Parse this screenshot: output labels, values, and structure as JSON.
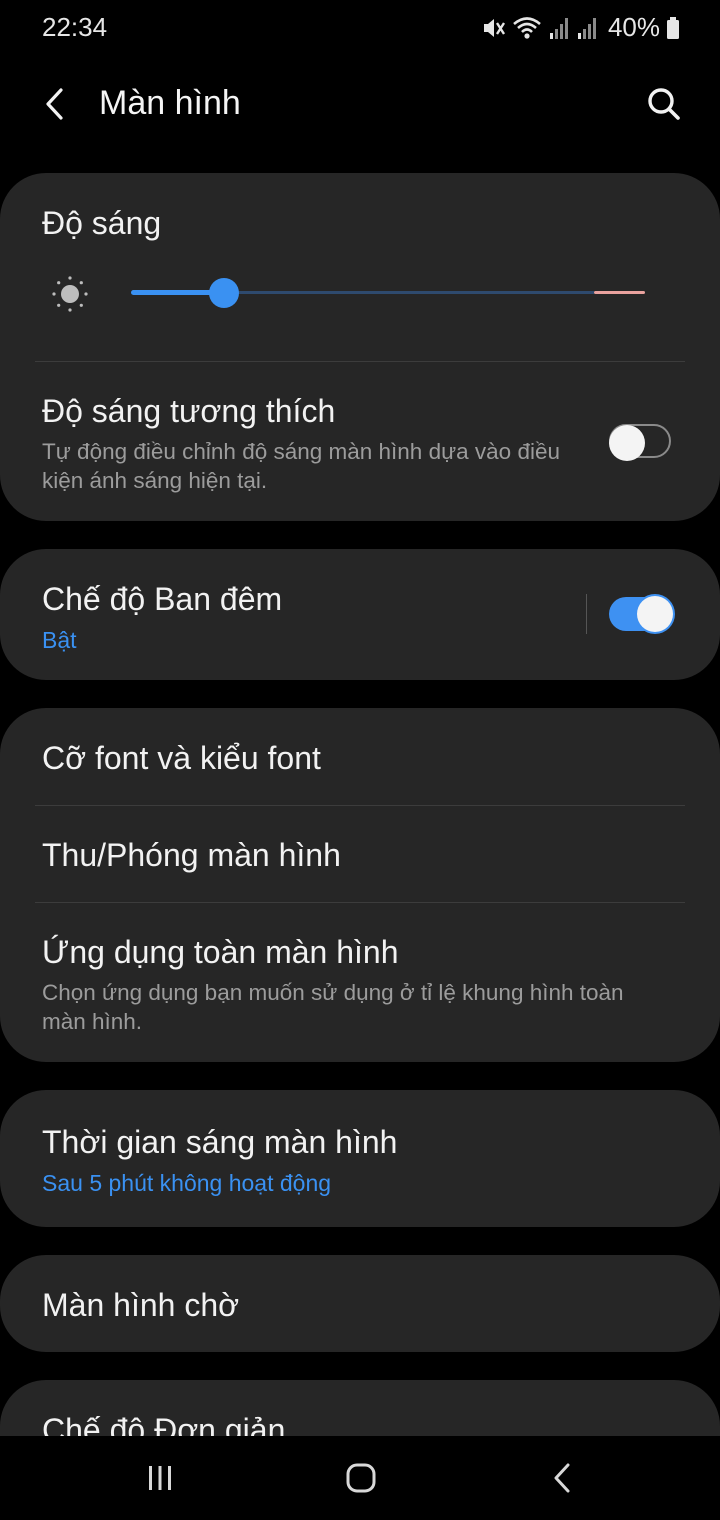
{
  "status_bar": {
    "time": "22:34",
    "battery": "40%"
  },
  "header": {
    "title": "Màn hình"
  },
  "brightness": {
    "title": "Độ sáng",
    "level": 0.18
  },
  "adaptive": {
    "title": "Độ sáng tương thích",
    "subtitle": "Tự động điều chỉnh độ sáng màn hình dựa vào điều kiện ánh sáng hiện tại.",
    "enabled": false
  },
  "night_mode": {
    "title": "Chế độ Ban đêm",
    "status": "Bật",
    "enabled": true
  },
  "font": {
    "title": "Cỡ font và kiểu font"
  },
  "zoom": {
    "title": "Thu/Phóng màn hình"
  },
  "fullscreen_apps": {
    "title": "Ứng dụng toàn màn hình",
    "subtitle": "Chọn ứng dụng bạn muốn sử dụng ở tỉ lệ khung hình toàn màn hình."
  },
  "timeout": {
    "title": "Thời gian sáng màn hình",
    "value": "Sau 5 phút không hoạt động"
  },
  "screensaver": {
    "title": "Màn hình chờ"
  },
  "easy_mode": {
    "title": "Chế độ Đơn giản"
  },
  "colors": {
    "accent": "#3a91f2",
    "card": "#262626",
    "background": "#000000"
  }
}
